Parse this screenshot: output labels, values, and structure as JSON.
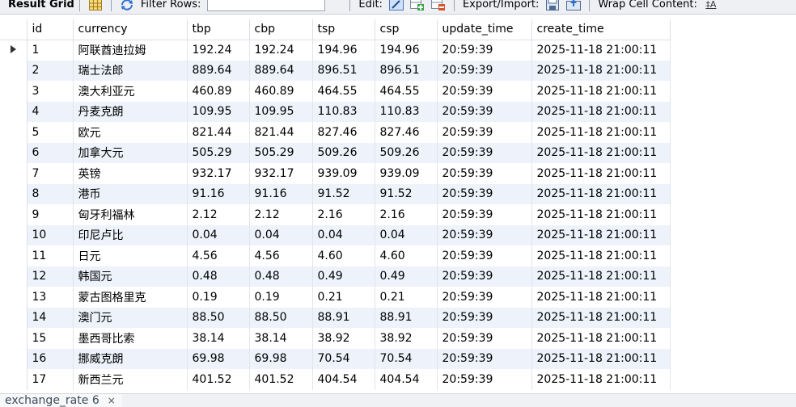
{
  "toolbar": {
    "result_grid_label": "Result Grid",
    "filter_rows_label": "Filter Rows:",
    "filter_rows_value": "",
    "edit_label": "Edit:",
    "export_import_label": "Export/Import:",
    "wrap_cell_label": "Wrap Cell Content:",
    "wrap_icon_glyph": "‡A",
    "icons": [
      "grid-view-icon",
      "refresh-icon",
      "edit-row-icon",
      "add-row-icon",
      "delete-row-icon",
      "export-icon",
      "import-icon",
      "wrap-cell-icon"
    ]
  },
  "grid": {
    "columns": [
      "id",
      "currency",
      "tbp",
      "cbp",
      "tsp",
      "csp",
      "update_time",
      "create_time"
    ],
    "rows": [
      [
        "1",
        "阿联酋迪拉姆",
        "192.24",
        "192.24",
        "194.96",
        "194.96",
        "20:59:39",
        "2025-11-18 21:00:11"
      ],
      [
        "2",
        "瑞士法郎",
        "889.64",
        "889.64",
        "896.51",
        "896.51",
        "20:59:39",
        "2025-11-18 21:00:11"
      ],
      [
        "3",
        "澳大利亚元",
        "460.89",
        "460.89",
        "464.55",
        "464.55",
        "20:59:39",
        "2025-11-18 21:00:11"
      ],
      [
        "4",
        "丹麦克朗",
        "109.95",
        "109.95",
        "110.83",
        "110.83",
        "20:59:39",
        "2025-11-18 21:00:11"
      ],
      [
        "5",
        "欧元",
        "821.44",
        "821.44",
        "827.46",
        "827.46",
        "20:59:39",
        "2025-11-18 21:00:11"
      ],
      [
        "6",
        "加拿大元",
        "505.29",
        "505.29",
        "509.26",
        "509.26",
        "20:59:39",
        "2025-11-18 21:00:11"
      ],
      [
        "7",
        "英镑",
        "932.17",
        "932.17",
        "939.09",
        "939.09",
        "20:59:39",
        "2025-11-18 21:00:11"
      ],
      [
        "8",
        "港币",
        "91.16",
        "91.16",
        "91.52",
        "91.52",
        "20:59:39",
        "2025-11-18 21:00:11"
      ],
      [
        "9",
        "匈牙利福林",
        "2.12",
        "2.12",
        "2.16",
        "2.16",
        "20:59:39",
        "2025-11-18 21:00:11"
      ],
      [
        "10",
        "印尼卢比",
        "0.04",
        "0.04",
        "0.04",
        "0.04",
        "20:59:39",
        "2025-11-18 21:00:11"
      ],
      [
        "11",
        "日元",
        "4.56",
        "4.56",
        "4.60",
        "4.60",
        "20:59:39",
        "2025-11-18 21:00:11"
      ],
      [
        "12",
        "韩国元",
        "0.48",
        "0.48",
        "0.49",
        "0.49",
        "20:59:39",
        "2025-11-18 21:00:11"
      ],
      [
        "13",
        "蒙古图格里克",
        "0.19",
        "0.19",
        "0.21",
        "0.21",
        "20:59:39",
        "2025-11-18 21:00:11"
      ],
      [
        "14",
        "澳门元",
        "88.50",
        "88.50",
        "88.91",
        "88.91",
        "20:59:39",
        "2025-11-18 21:00:11"
      ],
      [
        "15",
        "墨西哥比索",
        "38.14",
        "38.14",
        "38.92",
        "38.92",
        "20:59:39",
        "2025-11-18 21:00:11"
      ],
      [
        "16",
        "挪威克朗",
        "69.98",
        "69.98",
        "70.54",
        "70.54",
        "20:59:39",
        "2025-11-18 21:00:11"
      ],
      [
        "17",
        "新西兰元",
        "401.52",
        "401.52",
        "404.54",
        "404.54",
        "20:59:39",
        "2025-11-18 21:00:11"
      ]
    ],
    "selected_row": 0,
    "row_stripe_color": "#edf2fb"
  },
  "result_tab": {
    "label": "exchange_rate 6",
    "close_glyph": "×"
  }
}
